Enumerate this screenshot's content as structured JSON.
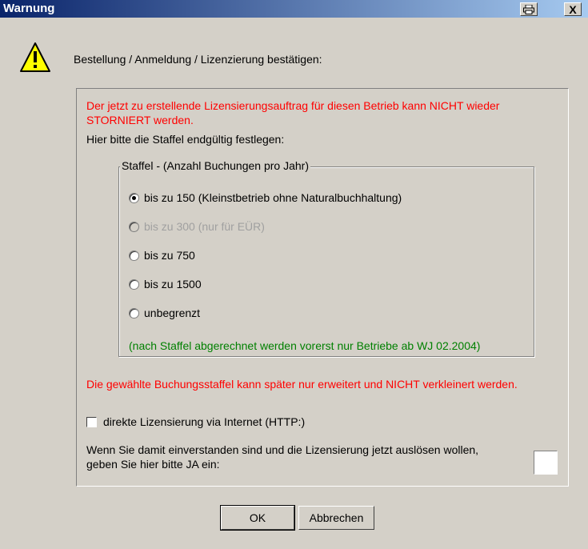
{
  "window": {
    "title": "Warnung"
  },
  "titlebar": {
    "print_icon": "printer-icon",
    "close_label": "X"
  },
  "header": {
    "text": "Bestellung / Anmeldung / Lizenzierung bestätigen:",
    "icon": "warning-icon"
  },
  "panel": {
    "intro_red": "Der jetzt zu erstellende Lizensierungsauftrag für diesen Betrieb kann NICHT wieder STORNIERT werden.",
    "staffel_prompt": "Hier bitte die Staffel endgültig festlegen:",
    "group": {
      "label": "Staffel - (Anzahl Buchungen pro Jahr)",
      "options": [
        {
          "label": "bis zu 150 (Kleinstbetrieb ohne Naturalbuchhaltung)",
          "checked": true,
          "disabled": false
        },
        {
          "label": "bis zu 300 (nur für EÜR)",
          "checked": false,
          "disabled": true
        },
        {
          "label": "bis zu 750",
          "checked": false,
          "disabled": false
        },
        {
          "label": "bis zu 1500",
          "checked": false,
          "disabled": false
        },
        {
          "label": "unbegrenzt",
          "checked": false,
          "disabled": false
        }
      ],
      "note": "(nach Staffel abgerechnet werden vorerst nur Betriebe ab WJ 02.2004)"
    },
    "warning_red": "Die gewählte Buchungsstaffel kann später nur erweitert und NICHT verkleinert werden.",
    "checkbox": {
      "label": "direkte Lizensierung via Internet (HTTP:)",
      "checked": false
    },
    "confirm_text": "Wenn Sie damit einverstanden sind und die Lizensierung jetzt auslösen wollen, geben Sie hier bitte JA ein:",
    "ja_input": {
      "value": ""
    }
  },
  "buttons": {
    "ok": "OK",
    "cancel": "Abbrechen"
  },
  "colors": {
    "warning_red": "#ff0000",
    "note_green": "#008000",
    "dialog_bg": "#d4d0c8"
  }
}
